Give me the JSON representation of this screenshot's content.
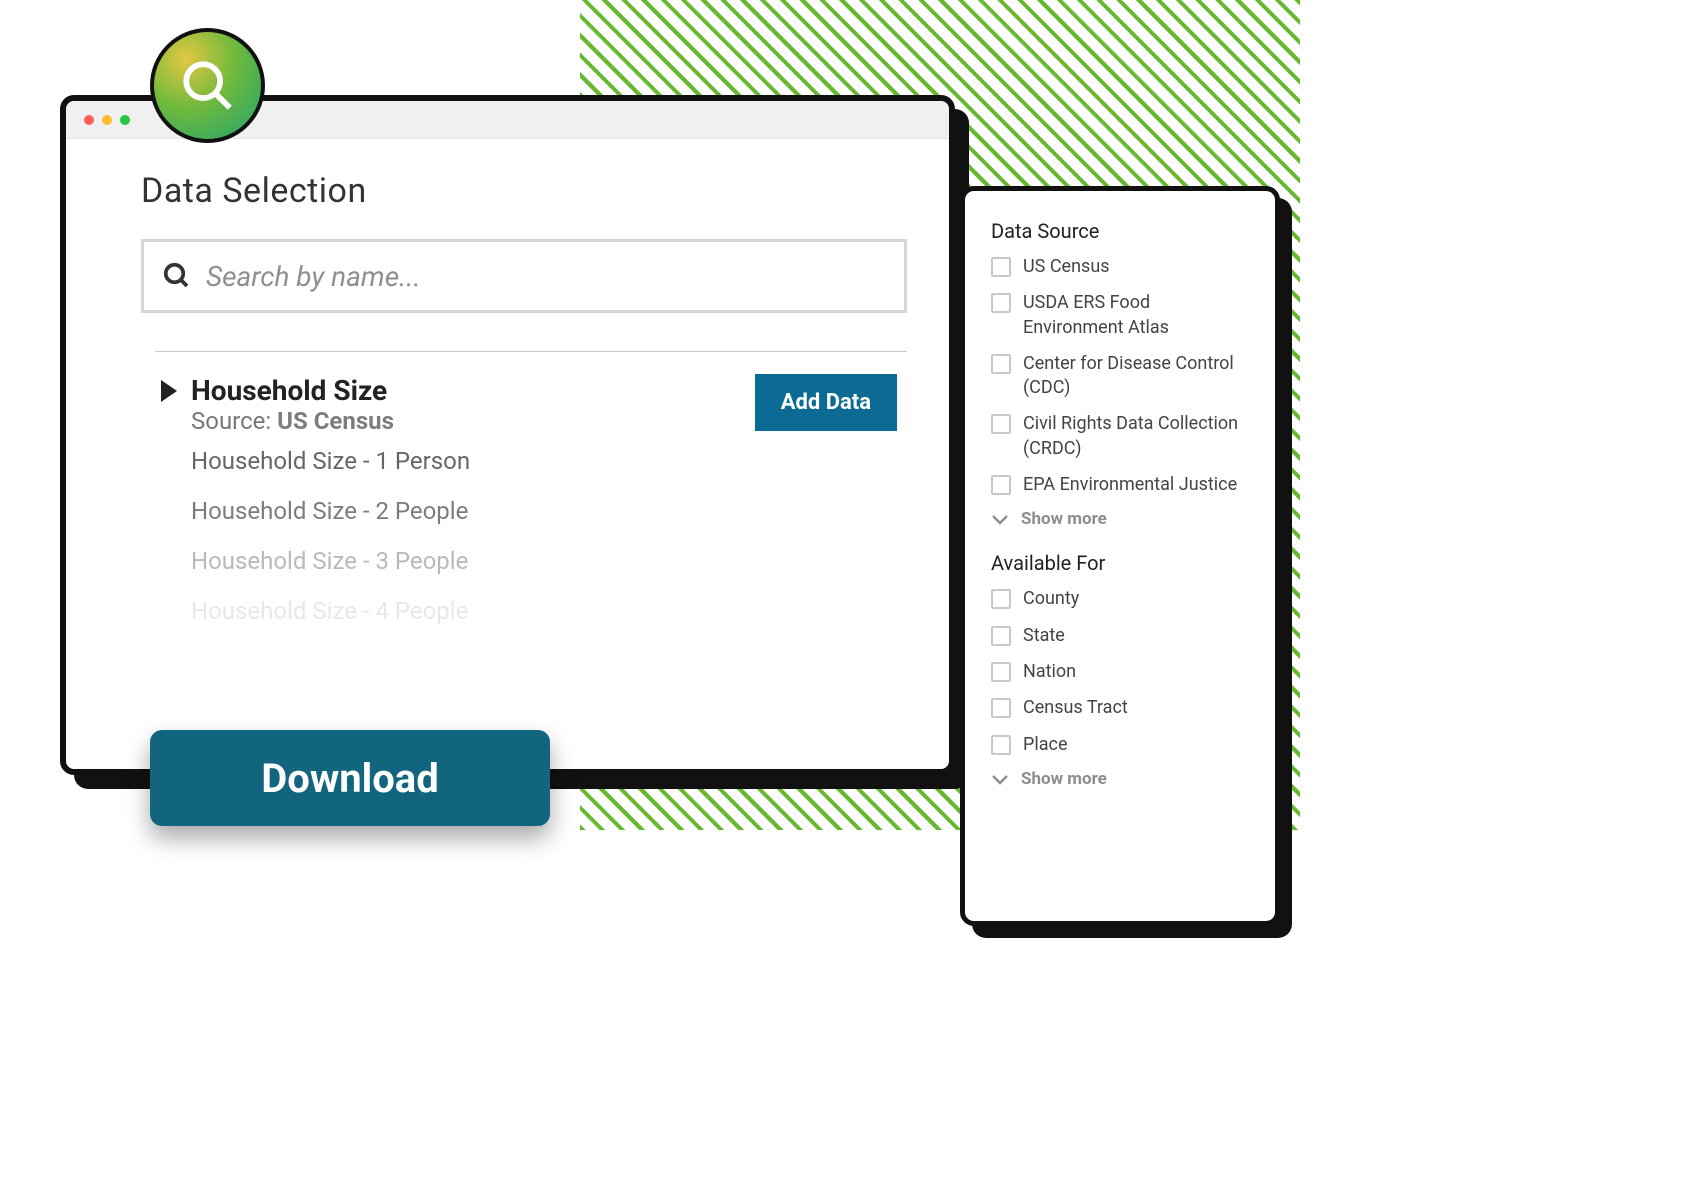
{
  "header": {
    "title": "Data Selection"
  },
  "search": {
    "placeholder": "Search by name..."
  },
  "result": {
    "title": "Household Size",
    "source_prefix": "Source: ",
    "source_name": "US Census",
    "add_label": "Add Data",
    "items": [
      "Household Size - 1 Person",
      "Household Size - 2 People",
      "Household Size - 3 People",
      "Household Size - 4 People"
    ]
  },
  "download_label": "Download",
  "facets": {
    "data_source": {
      "title": "Data Source",
      "options": [
        "US Census",
        "USDA ERS Food Environment Atlas",
        "Center for Disease Control (CDC)",
        "Civil Rights Data Collection (CRDC)",
        "EPA Environmental Justice"
      ],
      "show_more": "Show more"
    },
    "available_for": {
      "title": "Available For",
      "options": [
        "County",
        "State",
        "Nation",
        "Census Tract",
        "Place"
      ],
      "show_more": "Show more"
    }
  },
  "item_opacity": [
    1,
    0.85,
    0.45,
    0.15
  ],
  "colors": {
    "accent": "#0b6b95",
    "download": "#11657e",
    "hatch": "#66b82e"
  }
}
